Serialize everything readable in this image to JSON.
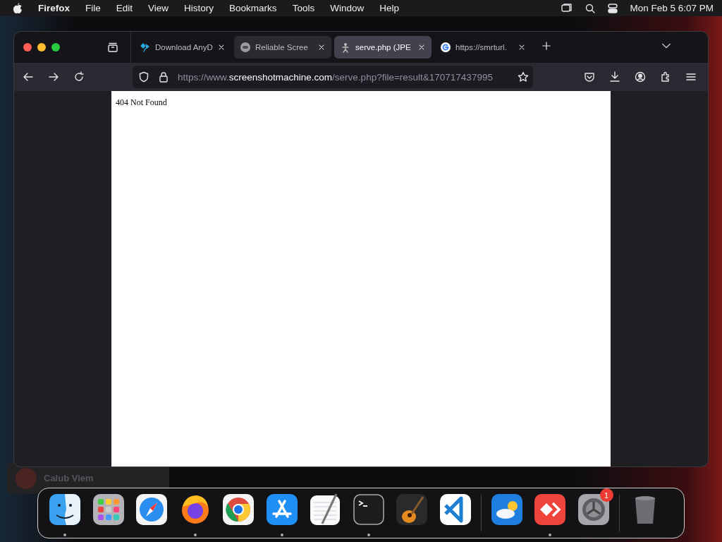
{
  "menu_bar": {
    "app": "Firefox",
    "items": [
      "File",
      "Edit",
      "View",
      "History",
      "Bookmarks",
      "Tools",
      "Window",
      "Help"
    ],
    "clock": "Mon Feb 5  6:07 PM"
  },
  "background_window": {
    "title": "Calub Viem"
  },
  "browser": {
    "tabs": [
      {
        "title": "Download AnyD",
        "kind": "anydesk",
        "selected": false,
        "hovered": false
      },
      {
        "title": "Reliable Scree",
        "kind": "robot",
        "selected": false,
        "hovered": true
      },
      {
        "title": "serve.php (JPE",
        "kind": "figure",
        "selected": true,
        "hovered": false
      },
      {
        "title": "https://smrturl.",
        "kind": "google",
        "selected": false,
        "hovered": false
      }
    ],
    "url": {
      "scheme": "https://www.",
      "host": "screenshotmachine.com",
      "path": "/serve.php?file=result&170717437995"
    },
    "page_text": "404 Not Found"
  },
  "dock": {
    "groups": [
      [
        {
          "kind": "finder",
          "running": true
        },
        {
          "kind": "launchpad",
          "running": false
        },
        {
          "kind": "safari",
          "running": false
        },
        {
          "kind": "firefox",
          "running": true
        },
        {
          "kind": "chrome",
          "running": false
        },
        {
          "kind": "appstore",
          "running": true
        },
        {
          "kind": "textedit",
          "running": false
        },
        {
          "kind": "terminal",
          "running": true
        },
        {
          "kind": "garageband",
          "running": false
        },
        {
          "kind": "vscode",
          "running": false
        }
      ],
      [
        {
          "kind": "weather",
          "running": false
        },
        {
          "kind": "anydesk",
          "running": true
        },
        {
          "kind": "settings",
          "running": false,
          "badge": "1"
        }
      ],
      [
        {
          "kind": "trash",
          "running": false
        }
      ]
    ]
  }
}
